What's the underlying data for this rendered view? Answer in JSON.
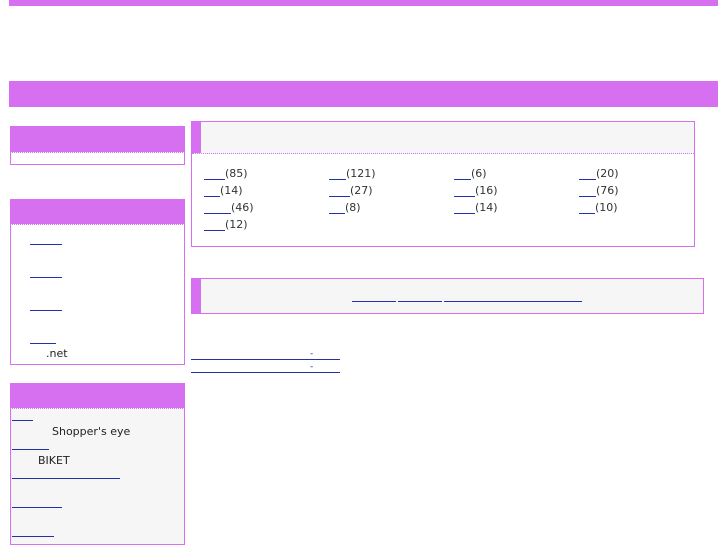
{
  "sidebar": {
    "links_box_footer": ".net",
    "partners": [
      {
        "label": "Shopper's eye"
      },
      {
        "label": "BIKET"
      }
    ]
  },
  "categories": {
    "items": [
      {
        "count": "(85)"
      },
      {
        "count": "(121)"
      },
      {
        "count": "(6)"
      },
      {
        "count": "(20)"
      },
      {
        "count": "(14)"
      },
      {
        "count": "(27)"
      },
      {
        "count": "(16)"
      },
      {
        "count": "(76)"
      },
      {
        "count": "(46)"
      },
      {
        "count": "(8)"
      },
      {
        "count": "(14)"
      },
      {
        "count": "(10)"
      },
      {
        "count": "(12)"
      }
    ]
  },
  "news": {
    "separator": "-"
  },
  "colors": {
    "accent": "#d770f0",
    "link": "#2233aa",
    "panel_bg": "#f6f6f6"
  }
}
